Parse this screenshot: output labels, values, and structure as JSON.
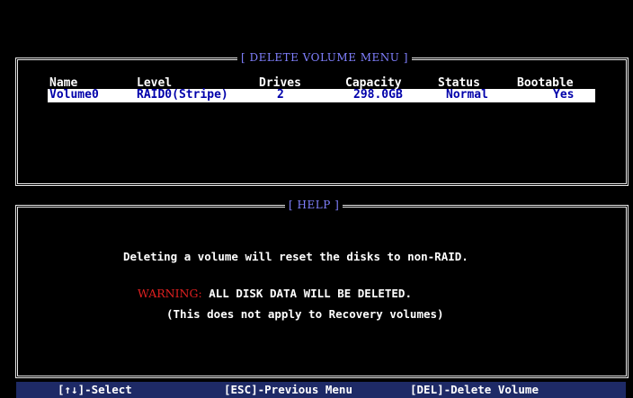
{
  "volume_panel": {
    "title": "[ DELETE VOLUME MENU ]",
    "columns": [
      "Name",
      "Level",
      "Drives",
      "Capacity",
      "Status",
      "Bootable"
    ],
    "rows": [
      {
        "name": "Volume0",
        "level": "RAID0(Stripe)",
        "drives": "2",
        "capacity": "298.0GB",
        "status": "Normal",
        "bootable": "Yes"
      }
    ]
  },
  "help_panel": {
    "title": "[ HELP ]",
    "line1": "Deleting a volume will reset the disks to non-RAID.",
    "warning_label": "WARNING:",
    "warning_text": " ALL DISK DATA WILL BE DELETED.",
    "line3": "(This does not apply to Recovery volumes)"
  },
  "footer": {
    "select": "[↑↓]-Select",
    "previous": "[ESC]-Previous Menu",
    "delete": "[DEL]-Delete Volume"
  },
  "colors": {
    "panel_title": "#8080ff",
    "selected_row_bg": "#ffffff",
    "selected_row_text": "#0000aa",
    "warning": "#e02020",
    "footer_bg": "#1e2a66"
  }
}
